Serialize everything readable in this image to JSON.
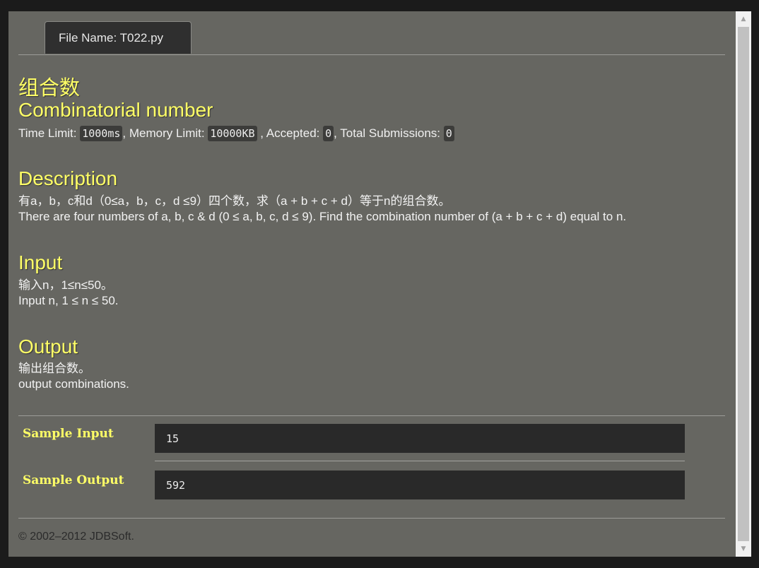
{
  "tab": {
    "label": "File Name:  T022.py"
  },
  "problem": {
    "title_cn": "组合数",
    "title_en": "Combinatorial number",
    "limits": {
      "time_label": "Time Limit: ",
      "time_value": "1000ms",
      "memory_label": ", Memory Limit: ",
      "memory_value": "10000KB",
      "accepted_label": " , Accepted: ",
      "accepted_value": "0",
      "submissions_label": ", Total Submissions: ",
      "submissions_value": "0"
    },
    "description": {
      "heading": "Description",
      "cn": "有a，b，c和d（0≤a，b，c，d ≤9）四个数，求（a + b + c + d）等于n的组合数。",
      "en": "There are four numbers of a, b, c & d (0 ≤ a, b, c, d ≤ 9). Find the combination number of (a + b + c + d) equal to n."
    },
    "input": {
      "heading": "Input",
      "cn": "输入n，1≤n≤50。",
      "en": "Input n, 1 ≤ n ≤ 50."
    },
    "output": {
      "heading": "Output",
      "cn": "输出组合数。",
      "en": "output combinations."
    },
    "sample": {
      "input_label": "Sample Input",
      "input_value": "15",
      "output_label": "Sample Output",
      "output_value": "592"
    }
  },
  "footer": {
    "text": "© 2002–2012  JDBSoft."
  },
  "colors": {
    "heading": "#ffff66",
    "background": "#666661",
    "code_bg": "#292929"
  }
}
